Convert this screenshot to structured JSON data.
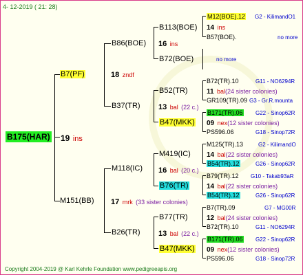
{
  "date": "4- 12-2019 ( 21: 28)",
  "footer": "Copyright 2004-2019 @ Karl Kehrle Foundation   www.pedigreeapis.org",
  "root": {
    "name": "B175(HAR)",
    "num": "19",
    "tag": "ins"
  },
  "father": {
    "name": "B7(PF)",
    "num": "18",
    "tag": "zndf"
  },
  "mother": {
    "name": "M151(BB)",
    "num": "17",
    "tag": "mrk",
    "note": "(33 sister colonies)"
  },
  "ff": {
    "name": "B86(BOE)",
    "num": "16",
    "tag": "ins"
  },
  "fm": {
    "name": "B37(TR)",
    "num": "13",
    "tag": "bal",
    "note": "(22 c.)"
  },
  "mf": {
    "name": "M118(IC)",
    "num": "16",
    "tag": "bal",
    "note": "(20 c.)"
  },
  "mm": {
    "name": "B26(TR)",
    "num": "13",
    "tag": "bal",
    "note": "(22 c.)"
  },
  "g3": [
    {
      "name": "B113(BOE)"
    },
    {
      "name": "B72(BOE)"
    },
    {
      "name": "B52(TR)",
      "num": "11",
      "tag": "bal",
      "note": "(24 sister colonies)"
    },
    {
      "name": "B47(MKK)",
      "num": "09",
      "tag": "nex",
      "note": "(12 sister colonies)"
    },
    {
      "name": "M419(IC)",
      "num": "14",
      "tag": "bal",
      "note": "(22 sister colonies)"
    },
    {
      "name": "B76(TR)",
      "num": "14",
      "tag": "bal",
      "note": "(22 sister colonies)"
    },
    {
      "name": "B77(TR)",
      "num": "12",
      "tag": "bal",
      "note": "(24 sister colonies)"
    },
    {
      "name": "B47(MKK)",
      "num": "09",
      "tag": "nex",
      "note": "(12 sister colonies)"
    }
  ],
  "g4": [
    {
      "name": "M12(BOE).12",
      "ref": "G2 - KilimandO1"
    },
    {
      "name": "B57(BOE).",
      "ref": "no more"
    },
    {
      "name": "no more",
      "ref": ""
    },
    {
      "name": "B72(TR).10",
      "ref": "G11 - NO6294R"
    },
    {
      "name": "GR109(TR).09",
      "ref": "G3 - Gr.R.mounta"
    },
    {
      "name": "B171(TR).06",
      "ref": "G22 - Sinop62R"
    },
    {
      "name": "PS596.06",
      "ref": "G18 - Sinop72R"
    },
    {
      "name": "M125(TR).13",
      "ref": "G2 - KilimandO"
    },
    {
      "name": "B54(TR).12",
      "ref": "G26 - Sinop62R"
    },
    {
      "name": "B79(TR).12",
      "ref": "G10 - Takab93aR"
    },
    {
      "name": "B54(TR).12",
      "ref": "G26 - Sinop62R"
    },
    {
      "name": "B7(TR).09",
      "ref": "G7 - MG00R"
    },
    {
      "name": "B72(TR).10",
      "ref": "G11 - NO6294R"
    },
    {
      "name": "B171(TR).06",
      "ref": "G22 - Sinop62R"
    },
    {
      "name": "PS596.06",
      "ref": "G18 - Sinop72R"
    }
  ],
  "g3_top": {
    "num": "14",
    "tag": "ins"
  }
}
